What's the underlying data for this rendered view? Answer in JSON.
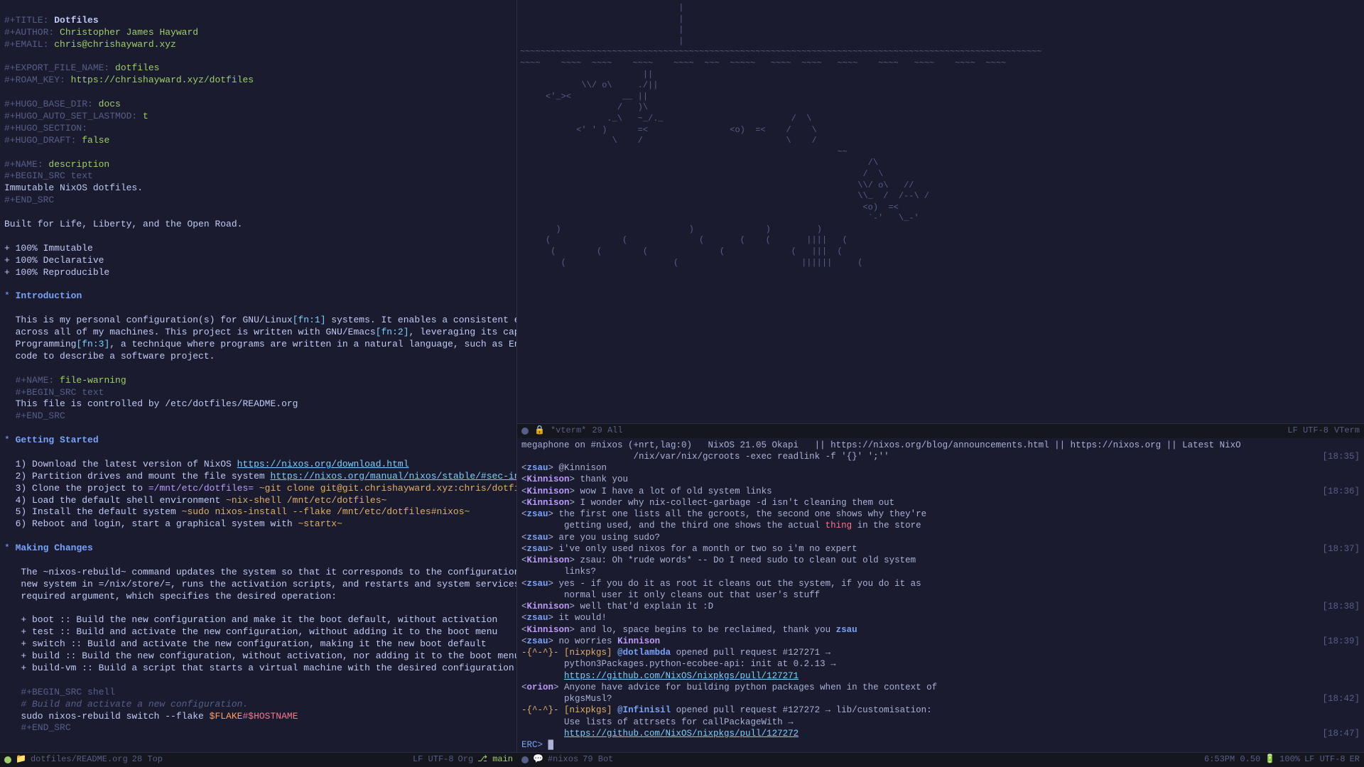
{
  "org": {
    "title_kw": "#+TITLE:",
    "title": "Dotfiles",
    "author_kw": "#+AUTHOR:",
    "author": "Christopher James Hayward",
    "email_kw": "#+EMAIL:",
    "email": "chris@chrishayward.xyz",
    "export_kw": "#+EXPORT_FILE_NAME:",
    "export": "dotfiles",
    "roam_kw": "#+ROAM_KEY:",
    "roam": "https://chrishayward.xyz/dotfiles",
    "hugo_base_kw": "#+HUGO_BASE_DIR:",
    "hugo_base": "docs",
    "hugo_lastmod_kw": "#+HUGO_AUTO_SET_LASTMOD:",
    "hugo_lastmod": "t",
    "hugo_section_kw": "#+HUGO_SECTION:",
    "hugo_draft_kw": "#+HUGO_DRAFT:",
    "hugo_draft": "false",
    "name_desc_kw": "#+NAME:",
    "name_desc": "description",
    "begin_src_text": "#+BEGIN_SRC text",
    "desc_body": "Immutable NixOS dotfiles.",
    "end_src": "#+END_SRC",
    "tagline": "Built for Life, Liberty, and the Open Road.",
    "bullets": [
      "+ 100% Immutable",
      "+ 100% Declarative",
      "+ 100% Reproducible"
    ],
    "intro_heading": "Introduction",
    "intro_p1a": "This is my personal configuration(s) for GNU/Linux",
    "intro_fn1": "[fn:1]",
    "intro_p1b": " systems. It enables a consistent experience and computing environment",
    "intro_p2a": "across all of my machines. This project is written with GNU/Emacs",
    "intro_fn2": "[fn:2]",
    "intro_p2b": ", leveraging its capabilities for Literate",
    "intro_p3a": "Programming",
    "intro_fn3": "[fn:3]",
    "intro_p3b": ", a technique where programs are written in a natural language, such as English, interspersed with snippets of",
    "intro_p4": "code to describe a software project.",
    "name_warn": "file-warning",
    "warn_body": "This file is controlled by /etc/dotfiles/README.org",
    "gs_heading": "Getting Started",
    "steps": {
      "s1a": "1) Download the latest version of NixOS ",
      "s1link": "https://nixos.org/download.html",
      "s2a": "2) Partition drives and mount the file system ",
      "s2link": "https://nixos.org/manual/nixos/stable/#sec-installation-partitioning",
      "s3a": "3) Clone the project to ",
      "s3path": "=/mnt/etc/dotfiles=",
      "s3cmd": " ~git clone git@git.chrishayward.xyz:chris/dotfiles /mnt/etc/dotfiles~",
      "s4a": "4) Load the default shell environment ",
      "s4cmd": "~nix-shell /mnt/etc/dotfiles~",
      "s5a": "5) Install the default system ",
      "s5cmd": "~sudo nixos-install --flake /mnt/etc/dotfiles#nixos~",
      "s6a": "6) Reboot and login, start a graphical system with ",
      "s6cmd": "~startx~"
    },
    "mc_heading": "Making Changes",
    "mc_p1": "The ~nixos-rebuild~ command updates the system so that it corresponds to the configuration specified in the module. It builds the",
    "mc_p2": "new system in =/nix/store/=, runs the activation scripts, and restarts and system services (if needed). The command has one",
    "mc_p3": "required argument, which specifies the desired operation:",
    "ops": [
      "+ boot :: Build the new configuration and make it the boot default, without activation",
      "+ test :: Build and activate the new configuration, without adding it to the boot menu",
      "+ switch :: Build and activate the new configuration, making it the new boot default",
      "+ build :: Build the new configuration, without activation, nor adding it to the boot menu",
      "+ build-vm :: Build a script that starts a virtual machine with the desired configuration"
    ],
    "begin_src_shell": "#+BEGIN_SRC shell",
    "shell_comment": "# Build and activate a new configuration.",
    "shell_cmd": "sudo nixos-rebuild switch --flake ",
    "shell_var1": "$FLAKE",
    "shell_hash": "#",
    "shell_var2": "$HOSTNAME"
  },
  "leftml": {
    "file": "dotfiles/README.org",
    "pos": "28 Top",
    "enc": "LF UTF-8",
    "mode": "Org",
    "branch": "main",
    "branch_icon": "⎇"
  },
  "vtermml": {
    "name": "*vterm*",
    "pos": "29 All",
    "enc": "LF UTF-8",
    "mode": "VTerm"
  },
  "topic": {
    "line1": "megaphone on #nixos (+nrt,lag:0)   NixOS 21.05 Okapi   || https://nixos.org/blog/announcements.html || https://nixos.org || Latest NixO",
    "line2": "                     /nix/var/nix/gcroots -exec readlink -f '{}' ';''",
    "ts": "[18:35]"
  },
  "chat": [
    {
      "nick": "zsau",
      "text": "@Kinnison",
      "cls": "nick2"
    },
    {
      "nick": "Kinnison",
      "text": "thank you",
      "cls": "nick"
    },
    {
      "nick": "Kinnison",
      "text": "wow I have a lot of old system links",
      "cls": "nick",
      "ts": "[18:36]"
    },
    {
      "nick": "Kinnison",
      "text": "I wonder why nix-collect-garbage -d isn't cleaning them out",
      "cls": "nick"
    },
    {
      "nick": "zsau",
      "text": "the first one lists all the gcroots, the second one shows why they're",
      "cls": "nick2"
    },
    {
      "cont": "        getting used, and the third one shows the actual ",
      "thing": "thing",
      "after": " in the store"
    },
    {
      "nick": "zsau",
      "text": "are you using sudo?",
      "cls": "nick2"
    },
    {
      "nick": "zsau",
      "text": "i've only used nixos for a month or two so i'm no expert",
      "cls": "nick2",
      "ts": "[18:37]"
    },
    {
      "nick": "Kinnison",
      "text": "zsau: Oh *rude words* -- Do I need sudo to clean out old system",
      "cls": "nick"
    },
    {
      "cont": "        links?"
    },
    {
      "nick": "zsau",
      "text": "yes - if you do it as root it cleans out the system, if you do it as",
      "cls": "nick2"
    },
    {
      "cont": "        normal user it only cleans out that user's stuff"
    },
    {
      "nick": "Kinnison",
      "text": "well that'd explain it :D",
      "cls": "nick",
      "ts": "[18:38]"
    },
    {
      "nick": "zsau",
      "text": "it would!",
      "cls": "nick2"
    },
    {
      "nick": "Kinnison",
      "text": "and lo, space begins to be reclaimed, thank you ",
      "after": "zsau",
      "aftercls": "nick2",
      "cls": "nick"
    },
    {
      "nick": "zsau",
      "text": "no worries ",
      "after": "Kinnison",
      "aftercls": "nick",
      "cls": "nick2",
      "ts": "[18:39]"
    },
    {
      "bot": "-{^-^}-",
      "tag": "[nixpkgs]",
      "who": "@dotlambda",
      "text": " opened pull request #127271 →"
    },
    {
      "cont": "        python3Packages.python-ecobee-api: init at 0.2.13 →"
    },
    {
      "link": "https://github.com/NixOS/nixpkgs/pull/127271"
    },
    {
      "nick": "orion",
      "text": "Anyone have advice for building python packages when in the context of",
      "cls": "nick"
    },
    {
      "cont": "        pkgsMusl?",
      "ts": "[18:42]"
    },
    {
      "bot": "-{^-^}-",
      "tag": "[nixpkgs]",
      "who": "@Infinisil",
      "text": " opened pull request #127272 → lib/customisation:"
    },
    {
      "cont": "        Use lists of attrsets for callPackageWith →"
    },
    {
      "link": "https://github.com/NixOS/nixpkgs/pull/127272",
      "ts": "[18:47]"
    }
  ],
  "erc_prompt": "ERC>",
  "rightml": {
    "channel": "#nixos",
    "pos": "79 Bot",
    "time": "6:53PM 0.50",
    "battery": "100%",
    "enc": "LF UTF-8",
    "mode": "ER"
  },
  "ascii": "                               |\n                               |\n                               |\n                               |\n~~~~~~~~~~~~~~~~~~~~~~~~~~~~~~~~~~~~~~~~~~~~~~~~~~~~~~~~~~~~~~~~~~~~~~~~~~~~~~~~~~~~~~~~~~~~~~~~~~~~~~\n~~~~    ~~~~  ~~~~    ~~~~    ~~~~  ~~~  ~~~~~   ~~~~  ~~~~   ~~~~    ~~~~   ~~~~    ~~~~  ~~~~\n                        ||\n            \\\\/ o\\     ./||\n     <'_><          __ ||\n                   /   )\\\n                 ._\\   ~_/._                         /  \\\n           <' ' )      =<                <o)  =<    /    \\\n                  \\    /                            \\    /\n                                                              ~~\n                                                                    /\\\n                                                                   /  \\\n                                                                  \\\\/ o\\   //\n                                                                  \\\\_  /  /--\\ /\n                                                                   <o)  =<\n                                                                    `-'   \\_-'\n       )                         )              )         )\n     (              (              (       (    (       ||||   (\n      (        (        (              (             (   |||  (\n        (                     (                        ||||||     ("
}
